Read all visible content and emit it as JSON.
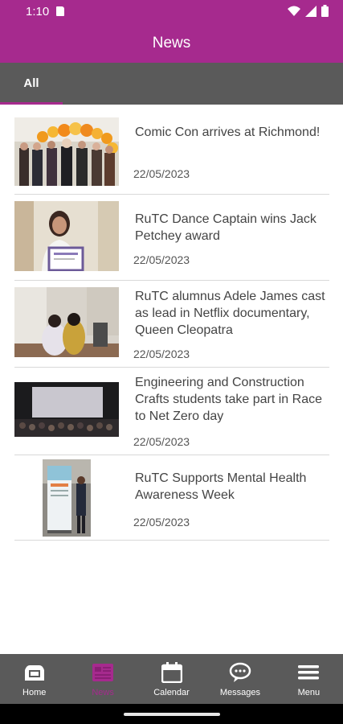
{
  "status_bar": {
    "time": "1:10"
  },
  "header": {
    "title": "News"
  },
  "tabs": [
    {
      "label": "All",
      "selected": true
    }
  ],
  "news": [
    {
      "title": "Comic Con arrives at Richmond!",
      "date": "22/05/2023"
    },
    {
      "title": "RuTC Dance Captain wins Jack Petchey award",
      "date": "22/05/2023"
    },
    {
      "title": "RuTC alumnus Adele James cast as lead in Netflix documentary, Queen Cleopatra",
      "date": "22/05/2023"
    },
    {
      "title": "Engineering and Construction Crafts students take part in Race to Net Zero day",
      "date": "22/05/2023"
    },
    {
      "title": "RuTC Supports Mental Health Awareness Week",
      "date": "22/05/2023"
    }
  ],
  "bottom_nav": [
    {
      "label": "Home",
      "icon": "home-icon",
      "active": false
    },
    {
      "label": "News",
      "icon": "news-icon",
      "active": true
    },
    {
      "label": "Calendar",
      "icon": "calendar-icon",
      "active": false
    },
    {
      "label": "Messages",
      "icon": "messages-icon",
      "active": false
    },
    {
      "label": "Menu",
      "icon": "menu-icon",
      "active": false
    }
  ],
  "colors": {
    "brand": "#a62a8e",
    "bar_gray": "#5a5a5a"
  }
}
